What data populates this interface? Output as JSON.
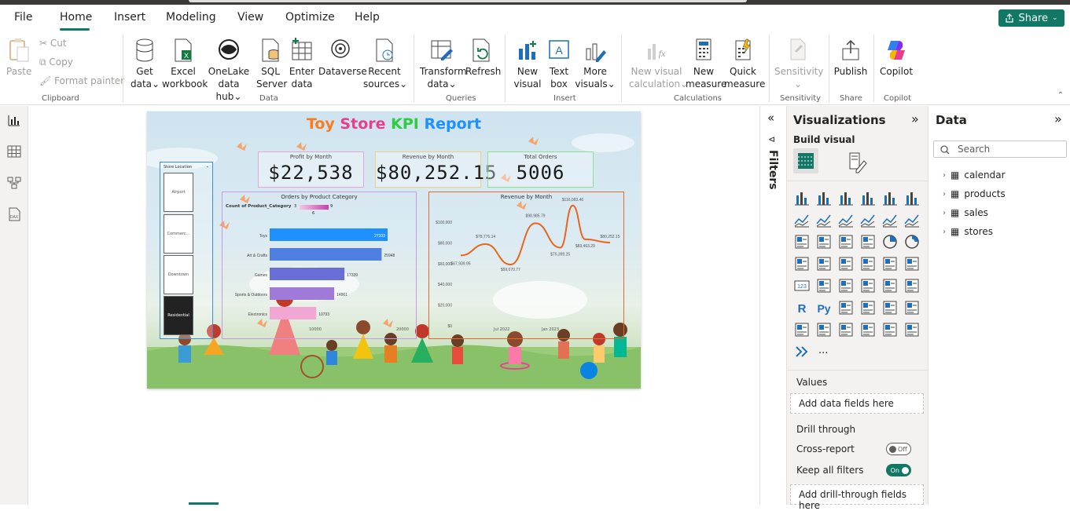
{
  "menu": {
    "file": "File",
    "home": "Home",
    "insert": "Insert",
    "modeling": "Modeling",
    "view": "View",
    "optimize": "Optimize",
    "help": "Help",
    "share": "Share"
  },
  "ribbon": {
    "paste": "Paste",
    "cut": "Cut",
    "copy": "Copy",
    "format_painter": "Format painter",
    "get_data_1": "Get",
    "get_data_2": "data",
    "excel_1": "Excel",
    "excel_2": "workbook",
    "onelake_1": "OneLake",
    "onelake_2": "data hub",
    "sql_1": "SQL",
    "sql_2": "Server",
    "enter_1": "Enter",
    "enter_2": "data",
    "dataverse": "Dataverse",
    "recent_1": "Recent",
    "recent_2": "sources",
    "transform_1": "Transform",
    "transform_2": "data",
    "refresh": "Refresh",
    "new_visual_1": "New",
    "new_visual_2": "visual",
    "textbox_1": "Text",
    "textbox_2": "box",
    "more_1": "More",
    "more_2": "visuals",
    "nvc_1": "New visual",
    "nvc_2": "calculation",
    "nm_1": "New",
    "nm_2": "measure",
    "qm_1": "Quick",
    "qm_2": "measure",
    "sensitivity": "Sensitivity",
    "publish": "Publish",
    "copilot": "Copilot",
    "groups": {
      "clipboard": "Clipboard",
      "data": "Data",
      "queries": "Queries",
      "insert": "Insert",
      "calculations": "Calculations",
      "sensitivity": "Sensitivity",
      "share": "Share",
      "copilot": "Copilot"
    }
  },
  "report": {
    "title_1": "Toy",
    "title_2": "Store",
    "title_3": "KPI",
    "title_4": "Report",
    "kpis": [
      {
        "title": "Profit by Month",
        "value": "$22,538"
      },
      {
        "title": "Revenue by Month",
        "value": "$80,252.15"
      },
      {
        "title": "Total Orders",
        "value": "5006"
      }
    ],
    "slicer": {
      "title": "Store Location",
      "items": [
        "Airport",
        "Commerc...",
        "Downtown",
        "Residential"
      ]
    },
    "orders_chart": {
      "title": "Orders by Product Category",
      "legend": "Count of Product_Category",
      "legend_min": "3",
      "legend_max": "9",
      "legend_mid": "6",
      "x_tick_1": "10000",
      "x_tick_2": "20000",
      "x_tick_3": "30000"
    },
    "revenue_chart": {
      "title": "Revenue by Month",
      "x_tick_1": "Jul 2022",
      "x_tick_2": "Jan 2023"
    }
  },
  "chart_data": [
    {
      "type": "bar",
      "title": "Orders by Product Category",
      "categories": [
        "Toys",
        "Art & Crafts",
        "Games",
        "Sports & Outdoors",
        "Electronics"
      ],
      "values": [
        27333,
        25948,
        17339,
        14961,
        10793
      ]
    },
    {
      "type": "line",
      "title": "Revenue by Month",
      "y_ticks": [
        "$100,000",
        "$80,000",
        "$60,000",
        "$40,000",
        "$20,000",
        "$0"
      ],
      "ylim": [
        0,
        100000
      ],
      "points": [
        67939.95,
        null,
        78776.14,
        null,
        59070.77,
        null,
        98985.79,
        null,
        75399.25,
        116083.46,
        83463.29,
        null,
        80252.15
      ],
      "labels": [
        "$67,939.95",
        "$78,776.14",
        "$59,070.77",
        "$98,985.79",
        "$75,399.25",
        "$116,083.46",
        "$83,463.29",
        "$80,252.15"
      ]
    }
  ],
  "filters": {
    "title": "Filters"
  },
  "viz": {
    "title": "Visualizations",
    "build": "Build visual",
    "values": "Values",
    "values_placeholder": "Add data fields here",
    "drill": "Drill through",
    "cross": "Cross-report",
    "cross_state": "Off",
    "keep": "Keep all filters",
    "keep_state": "On",
    "drill_placeholder": "Add drill-through fields here",
    "more": "..."
  },
  "data": {
    "title": "Data",
    "search_placeholder": "Search",
    "tables": [
      "calendar",
      "products",
      "sales",
      "stores"
    ]
  },
  "colors": {
    "accent": "#117865",
    "title_orange": "#f97b22",
    "title_pink": "#e83e8c",
    "title_green": "#2ecc40",
    "title_blue": "#1e90ff"
  }
}
